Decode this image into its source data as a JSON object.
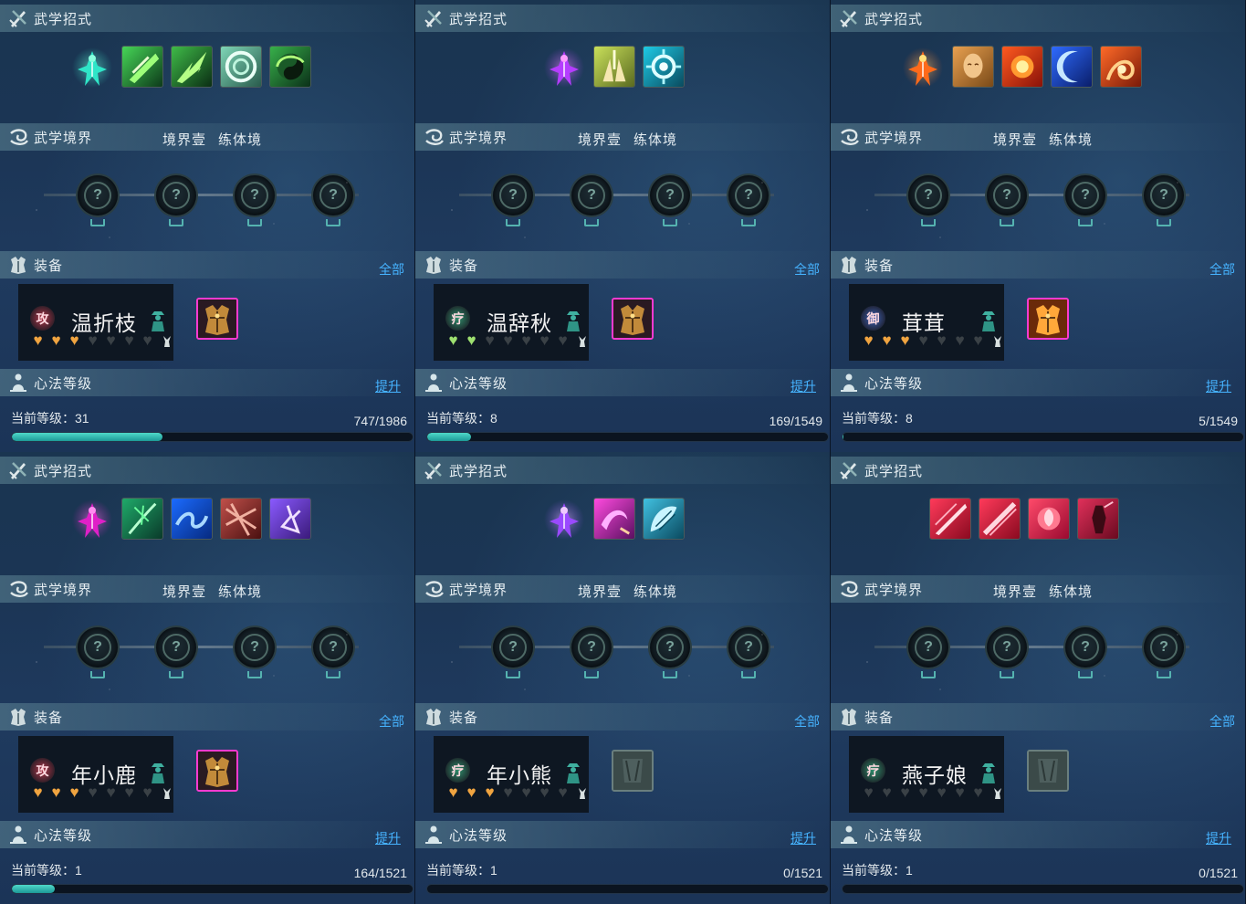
{
  "labels": {
    "skills_header": "武学招式",
    "realm_header": "武学境界",
    "realm_level": "境界壹",
    "realm_name": "练体境",
    "equip_header": "装备",
    "equip_all": "全部",
    "xinfa_header": "心法等级",
    "xinfa_upgrade": "提升",
    "level_prefix": "当前等级："
  },
  "icons": {
    "skills_header": "swords-icon",
    "realm_header": "swirl-icon",
    "equip_header": "armor-icon",
    "xinfa_header": "meditating-figure-icon",
    "realm_node": "locked-node-icon"
  },
  "panels": [
    {
      "character": "温折枝",
      "badge_char": "攻",
      "badge_color": "#b0374a",
      "hearts": [
        "gold",
        "gold",
        "gold",
        "empty",
        "empty",
        "empty",
        "empty"
      ],
      "level": "31",
      "exp_text": "747/1986",
      "progress": 0.376,
      "skill_icons": [
        "green-spirit-figure",
        "green-slash",
        "green-burst",
        "jade-ring",
        "yin-yang-green"
      ],
      "equipment": "ornate-armor-purple-frame"
    },
    {
      "character": "温辞秋",
      "badge_char": "疗",
      "badge_color": "#2f8f6c",
      "hearts": [
        "green",
        "green",
        "empty",
        "empty",
        "empty",
        "empty",
        "empty"
      ],
      "level": "8",
      "exp_text": "169/1549",
      "progress": 0.109,
      "skill_icons": [
        "purple-spirit-figure",
        "healing-hands",
        "cyan-vortex"
      ],
      "equipment": "ornate-armor-purple-frame"
    },
    {
      "character": "茸茸",
      "badge_char": "御",
      "badge_color": "#3f62b8",
      "hearts": [
        "gold",
        "gold",
        "gold",
        "empty",
        "empty",
        "empty",
        "empty"
      ],
      "level": "8",
      "exp_text": "5/1549",
      "progress": 0.003,
      "skill_icons": [
        "fire-figure",
        "golden-buddha",
        "fire-burst",
        "blue-crescent",
        "fire-orb"
      ],
      "equipment": "golden-armor-pink-frame"
    },
    {
      "character": "年小鹿",
      "badge_char": "攻",
      "badge_color": "#b0374a",
      "hearts": [
        "gold",
        "gold",
        "gold",
        "empty",
        "empty",
        "empty",
        "empty"
      ],
      "level": "1",
      "exp_text": "164/1521",
      "progress": 0.108,
      "skill_icons": [
        "magenta-sigil",
        "green-vine",
        "blue-wave",
        "red-thorns",
        "purple-dancer"
      ],
      "equipment": "ornate-armor-purple-frame"
    },
    {
      "character": "年小熊",
      "badge_char": "疗",
      "badge_color": "#2f8f6c",
      "hearts": [
        "gold",
        "gold",
        "gold",
        "empty",
        "empty",
        "empty",
        "empty"
      ],
      "level": "1",
      "exp_text": "0/1521",
      "progress": 0,
      "skill_icons": [
        "purple-cone",
        "purple-claw",
        "cyan-shell"
      ],
      "equipment": "empty-slot"
    },
    {
      "character": "燕子娘",
      "badge_char": "疗",
      "badge_color": "#2f8f6c",
      "hearts": [
        "empty",
        "empty",
        "empty",
        "empty",
        "empty",
        "empty",
        "empty"
      ],
      "level": "1",
      "exp_text": "0/1521",
      "progress": 0,
      "skill_icons": [
        "red-slash",
        "red-slash-2",
        "red-rose",
        "red-warrior"
      ],
      "equipment": "empty-slot"
    }
  ]
}
